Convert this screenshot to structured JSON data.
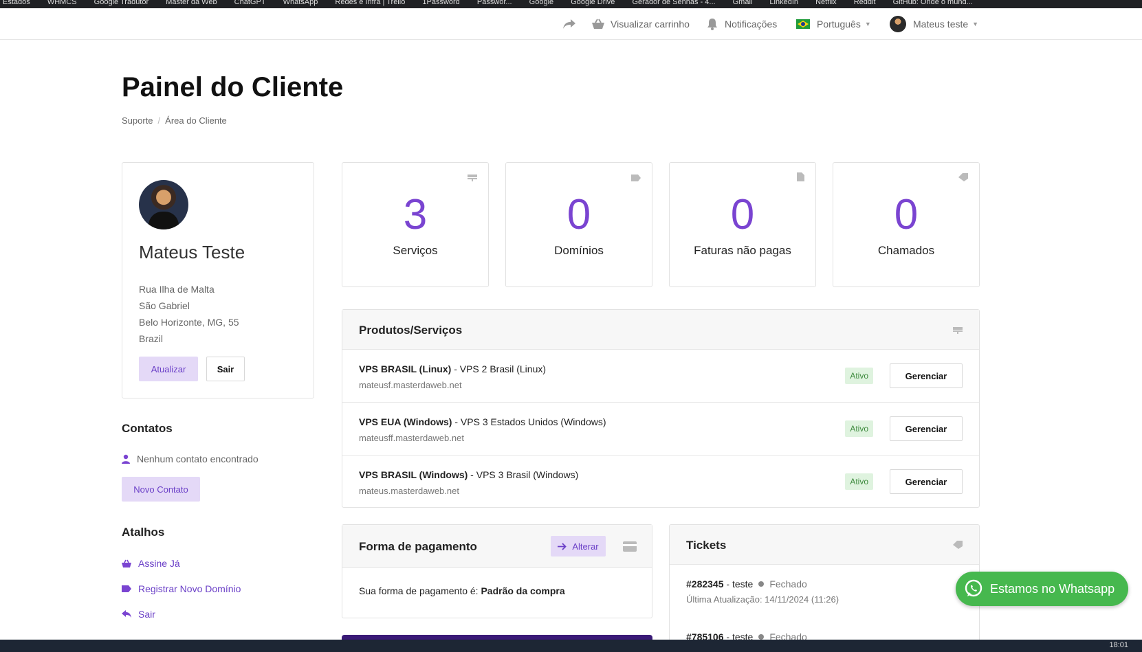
{
  "bookmarks": [
    "Estados",
    "WHMCS",
    "Google Tradutor",
    "Master da Web",
    "ChatGPT",
    "WhatsApp",
    "Redes e Infra | Trello",
    "1Password",
    "Passwor...",
    "Google",
    "Google Drive",
    "Gerador de Senhas - 4...",
    "Gmail",
    "LinkedIn",
    "Netflix",
    "Reddit",
    "GitHub: Onde o mund..."
  ],
  "topnav": {
    "cart_label": "Visualizar carrinho",
    "notifications_label": "Notificações",
    "language_label": "Português",
    "user_label": "Mateus teste"
  },
  "page": {
    "title": "Painel do Cliente",
    "breadcrumb": [
      "Suporte",
      "Área do Cliente"
    ]
  },
  "profile": {
    "name": "Mateus Teste",
    "address": [
      "Rua Ilha de Malta",
      "São Gabriel",
      "Belo Horizonte, MG, 55",
      "Brazil"
    ],
    "update_label": "Atualizar",
    "logout_label": "Sair"
  },
  "contacts": {
    "heading": "Contatos",
    "empty_text": "Nenhum contato encontrado",
    "new_label": "Novo Contato"
  },
  "shortcuts": {
    "heading": "Atalhos",
    "items": [
      "Assine Já",
      "Registrar Novo Domínio",
      "Sair"
    ]
  },
  "stats": [
    {
      "value": "3",
      "label": "Serviços",
      "icon": "server-icon"
    },
    {
      "value": "0",
      "label": "Domínios",
      "icon": "tag-icon"
    },
    {
      "value": "0",
      "label": "Faturas não pagas",
      "icon": "document-icon"
    },
    {
      "value": "0",
      "label": "Chamados",
      "icon": "ticket-icon"
    }
  ],
  "services": {
    "heading": "Produtos/Serviços",
    "rows": [
      {
        "name": "VPS BRASIL (Linux)",
        "plan": " - VPS 2 Brasil (Linux)",
        "host": "mateusf.masterdaweb.net",
        "status": "Ativo",
        "action": "Gerenciar"
      },
      {
        "name": "VPS EUA (Windows)",
        "plan": " - VPS 3 Estados Unidos (Windows)",
        "host": "mateusff.masterdaweb.net",
        "status": "Ativo",
        "action": "Gerenciar"
      },
      {
        "name": "VPS BRASIL (Windows)",
        "plan": " - VPS 3 Brasil (Windows)",
        "host": "mateus.masterdaweb.net",
        "status": "Ativo",
        "action": "Gerenciar"
      }
    ]
  },
  "payment": {
    "heading": "Forma de pagamento",
    "change_label": "Alterar",
    "text": "Sua forma de pagamento é: ",
    "method": "Padrão da compra"
  },
  "tickets": {
    "heading": "Tickets",
    "items": [
      {
        "id": "#282345",
        "subject": " - teste",
        "status": "Fechado",
        "updated": "Última Atualização: 14/11/2024 (11:26)"
      },
      {
        "id": "#785106",
        "subject": " - teste",
        "status": "Fechado"
      }
    ]
  },
  "whatsapp_label": "Estamos no Whatsapp",
  "clock": "18:01",
  "colors": {
    "accent": "#7a44d1",
    "soft_accent": "#e4d9f7",
    "success_bg": "#dff3df",
    "whatsapp": "#46b84e"
  }
}
